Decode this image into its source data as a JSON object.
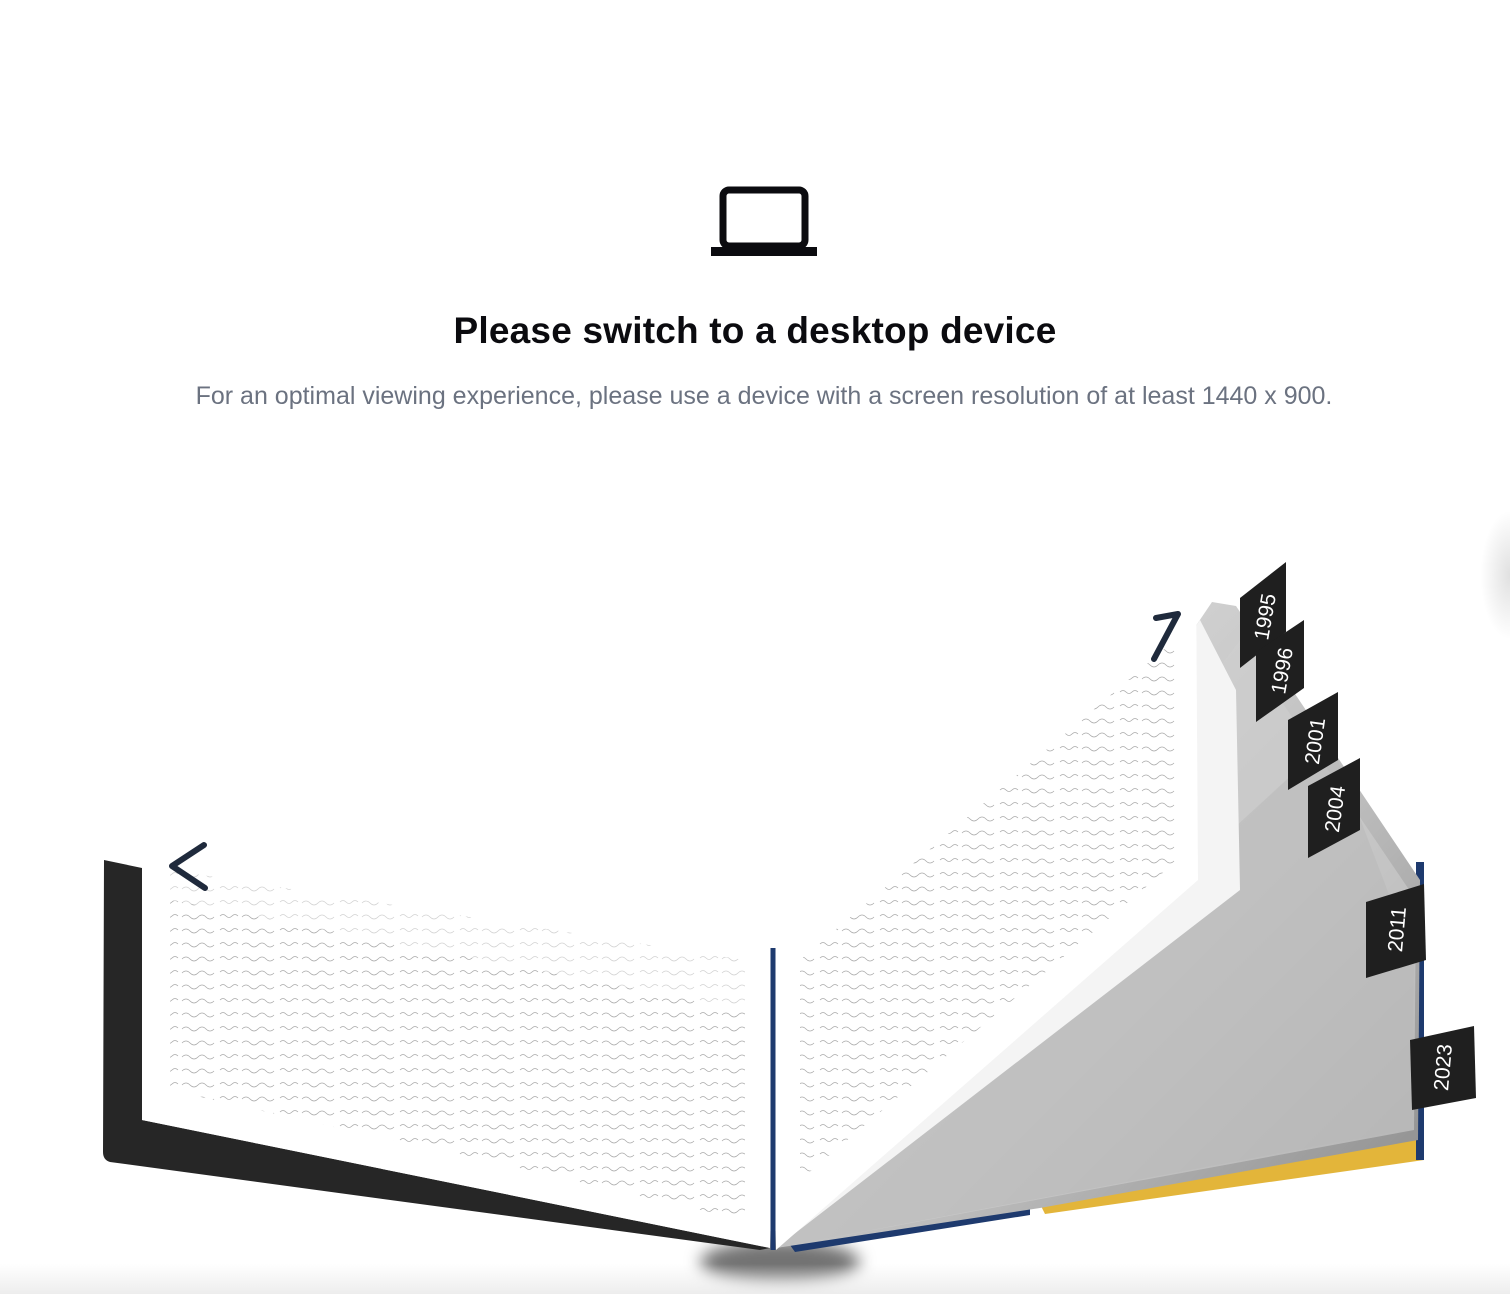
{
  "notice": {
    "icon": "laptop-icon",
    "title": "Please switch to a desktop device",
    "message": "For an optimal viewing experience, please use a device with a screen resolution of at least 1440 x 900."
  },
  "book": {
    "prev_icon": "chevron-left-icon",
    "next_icon": "chevron-right-icon",
    "year_tabs": [
      "1995",
      "1996",
      "2001",
      "2004",
      "2011",
      "2023"
    ],
    "colors": {
      "cover_dark": "#262626",
      "spine_blue": "#1e3a6e",
      "cover_yellow": "#e3b53a",
      "tab_bg": "#1f1f1f"
    }
  }
}
